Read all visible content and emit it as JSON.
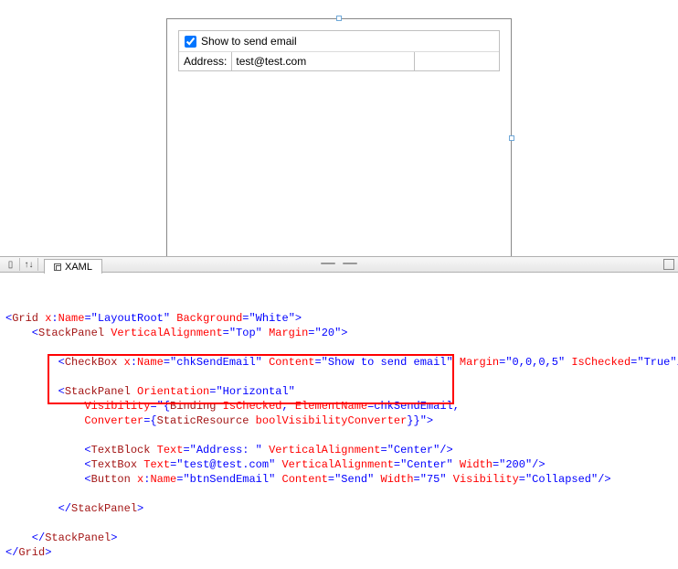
{
  "designer": {
    "checkbox_label": "Show to send email",
    "address_label": "Address:",
    "address_value": "test@test.com"
  },
  "tab": {
    "label": "XAML"
  },
  "code": {
    "l1_a": "<",
    "l1_b": "Grid",
    "l1_c": " x",
    "l1_d": ":",
    "l1_e": "Name",
    "l1_f": "=\"LayoutRoot\"",
    "l1_g": " Background",
    "l1_h": "=\"White\">",
    "l2_a": "    <",
    "l2_b": "StackPanel",
    "l2_c": " VerticalAlignment",
    "l2_d": "=\"Top\"",
    "l2_e": " Margin",
    "l2_f": "=\"20\">",
    "l3": "",
    "l4_a": "        <",
    "l4_b": "CheckBox",
    "l4_c": " x",
    "l4_d": ":",
    "l4_e": "Name",
    "l4_f": "=\"chkSendEmail\"",
    "l4_g": " Content",
    "l4_h": "=\"Show to send email\"",
    "l4_i": " Margin",
    "l4_j": "=\"0,0,0,5\"",
    "l4_k": " IsChecked",
    "l4_l": "=\"True\"/>",
    "l5": "",
    "l6_a": "        <",
    "l6_b": "StackPanel",
    "l6_c": " Orientation",
    "l6_d": "=\"Horizontal\"",
    "l7_a": "            Visibility",
    "l7_b": "=\"{",
    "l7_c": "Binding",
    "l7_d": " IsChecked",
    "l7_e": ",",
    "l7_f": " ElementName",
    "l7_g": "=chkSendEmail,",
    "l8_a": "            Converter",
    "l8_b": "={",
    "l8_c": "StaticResource",
    "l8_d": " boolVisibilityConverter",
    "l8_e": "}}\">",
    "l9": "",
    "l10_a": "            <",
    "l10_b": "TextBlock",
    "l10_c": " Text",
    "l10_d": "=\"Address: \"",
    "l10_e": " VerticalAlignment",
    "l10_f": "=\"Center\"/>",
    "l11_a": "            <",
    "l11_b": "TextBox",
    "l11_c": " Text",
    "l11_d": "=\"test@test.com\"",
    "l11_e": " VerticalAlignment",
    "l11_f": "=\"Center\"",
    "l11_g": " Width",
    "l11_h": "=\"200\"/>",
    "l12_a": "            <",
    "l12_b": "Button",
    "l12_c": " x",
    "l12_d": ":",
    "l12_e": "Name",
    "l12_f": "=\"btnSendEmail\"",
    "l12_g": " Content",
    "l12_h": "=\"Send\"",
    "l12_i": " Width",
    "l12_j": "=\"75\"",
    "l12_k": " Visibility",
    "l12_l": "=\"Collapsed\"/>",
    "l13": "",
    "l14_a": "        </",
    "l14_b": "StackPanel",
    "l14_c": ">",
    "l15": "",
    "l16_a": "    </",
    "l16_b": "StackPanel",
    "l16_c": ">",
    "l17_a": "</",
    "l17_b": "Grid",
    "l17_c": ">"
  }
}
